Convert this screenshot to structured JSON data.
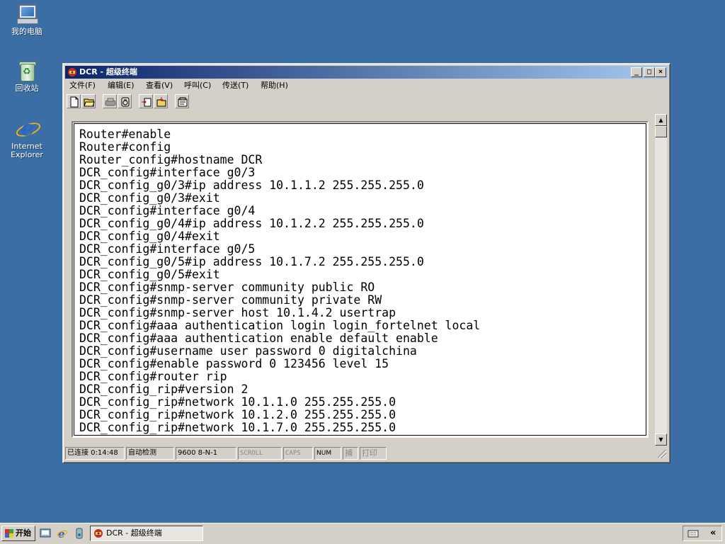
{
  "desktop": {
    "icons": [
      {
        "label": "我的电脑",
        "icon": "my-computer-icon"
      },
      {
        "label": "回收站",
        "icon": "recycle-bin-icon"
      },
      {
        "label_line1": "Internet",
        "label_line2": "Explorer",
        "icon": "internet-explorer-icon"
      }
    ]
  },
  "window": {
    "title": "DCR - 超级终端",
    "controls": {
      "minimize": "_",
      "maximize": "□",
      "close": "×"
    },
    "menu": [
      "文件(F)",
      "编辑(E)",
      "查看(V)",
      "呼叫(C)",
      "传送(T)",
      "帮助(H)"
    ],
    "toolbar_icons": [
      "new-file-icon",
      "open-folder-icon",
      "dial-icon",
      "disconnect-icon",
      "send-icon",
      "receive-icon",
      "properties-icon"
    ]
  },
  "terminal": {
    "lines": [
      "Router#enable",
      "Router#config",
      "Router_config#hostname DCR",
      "DCR_config#interface g0/3",
      "DCR_config_g0/3#ip address 10.1.1.2 255.255.255.0",
      "DCR_config_g0/3#exit",
      "DCR_config#interface g0/4",
      "DCR_config_g0/4#ip address 10.1.2.2 255.255.255.0",
      "DCR_config_g0/4#exit",
      "DCR_config#interface g0/5",
      "DCR_config_g0/5#ip address 10.1.7.2 255.255.255.0",
      "DCR_config_g0/5#exit",
      "DCR_config#snmp-server community public RO",
      "DCR_config#snmp-server community private RW",
      "DCR_config#snmp-server host 10.1.4.2 usertrap",
      "DCR_config#aaa authentication login login_fortelnet local",
      "DCR_config#aaa authentication enable default enable",
      "DCR_config#username user password 0 digitalchina",
      "DCR_config#enable password 0 123456 level 15",
      "DCR_config#router rip",
      "DCR_config_rip#version 2",
      "DCR_config_rip#network 10.1.1.0 255.255.255.0",
      "DCR_config_rip#network 10.1.2.0 255.255.255.0",
      "DCR_config_rip#network 10.1.7.0 255.255.255.0"
    ]
  },
  "statusbar": {
    "connected": "已连接 0:14:48",
    "detect": "自动检测",
    "baud": "9600 8-N-1",
    "scroll": "SCROLL",
    "caps": "CAPS",
    "num": "NUM",
    "capture": "捕",
    "print": "打印"
  },
  "taskbar": {
    "start_label": "开始",
    "quick_launch": [
      "show-desktop-icon",
      "internet-explorer-icon",
      "media-icon"
    ],
    "task_label": "DCR - 超级终端",
    "tray_icons": [
      "keyboard-icon",
      "chevron-left-icon"
    ]
  }
}
